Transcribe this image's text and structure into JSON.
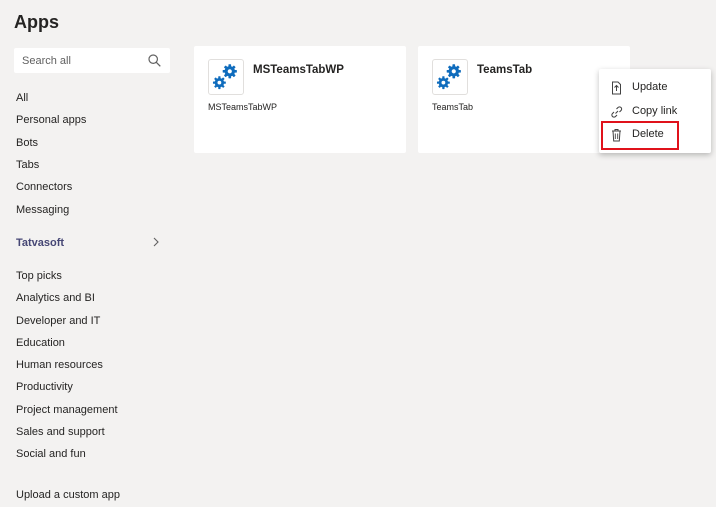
{
  "page": {
    "title": "Apps"
  },
  "search": {
    "placeholder": "Search all"
  },
  "categories": [
    "All",
    "Personal apps",
    "Bots",
    "Tabs",
    "Connectors",
    "Messaging"
  ],
  "org": {
    "label": "Tatvasoft"
  },
  "topics": [
    "Top picks",
    "Analytics and BI",
    "Developer and IT",
    "Education",
    "Human resources",
    "Productivity",
    "Project management",
    "Sales and support",
    "Social and fun"
  ],
  "upload": {
    "label": "Upload a custom app"
  },
  "apps": [
    {
      "name": "MSTeamsTabWP",
      "subtitle": "MSTeamsTabWP",
      "icon": "gear-icon"
    },
    {
      "name": "TeamsTab",
      "subtitle": "TeamsTab",
      "icon": "gear-icon"
    }
  ],
  "context_menu": {
    "items": [
      {
        "label": "Update",
        "icon": "update-icon"
      },
      {
        "label": "Copy link",
        "icon": "link-icon"
      },
      {
        "label": "Delete",
        "icon": "trash-icon"
      }
    ]
  },
  "colors": {
    "accent": "#464775",
    "gear": "#0f6cbd",
    "highlight": "#e0121b",
    "background": "#f3f2f1"
  }
}
